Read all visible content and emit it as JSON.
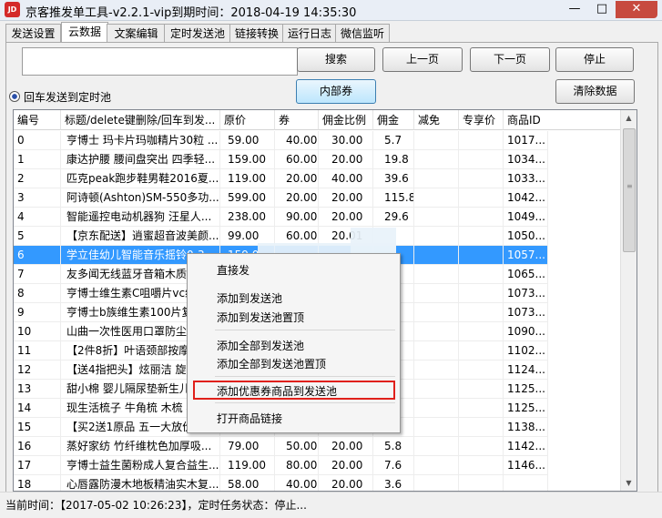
{
  "window": {
    "title": "京客推发单工具-v2.2.1-vip到期时间：2018-04-19 14:35:30",
    "icon_text": "JD"
  },
  "tabs": [
    "发送设置",
    "云数据",
    "文案编辑",
    "定时发送池",
    "链接转换",
    "运行日志",
    "微信监听"
  ],
  "active_tab": 1,
  "toolbar": {
    "search_value": "",
    "search_label": "搜索",
    "prev_label": "上一页",
    "next_label": "下一页",
    "stop_label": "停止",
    "internal_coupon_label": "内部券",
    "clear_label": "清除数据",
    "radio_label": "回车发送到定时池"
  },
  "table": {
    "columns": [
      "编号",
      "标题/delete键删除/回车到发...",
      "原价",
      "券",
      "佣金比例",
      "佣金",
      "减免",
      "专享价",
      "商品ID"
    ],
    "rows": [
      [
        "0",
        "亨博士 玛卡片玛咖精片30粒 ...",
        "59.00",
        "40.00",
        "30.00",
        "5.7",
        "",
        "",
        "1017..."
      ],
      [
        "1",
        "康达护腰 腰间盘突出 四季轻...",
        "159.00",
        "60.00",
        "20.00",
        "19.8",
        "",
        "",
        "1034..."
      ],
      [
        "2",
        "匹克peak跑步鞋男鞋2016夏...",
        "119.00",
        "20.00",
        "40.00",
        "39.6",
        "",
        "",
        "1033..."
      ],
      [
        "3",
        "阿诗顿(Ashton)SM-550多功...",
        "599.00",
        "20.00",
        "20.00",
        "115.8",
        "",
        "",
        "1042..."
      ],
      [
        "4",
        "智能遥控电动机器狗 汪星人...",
        "238.00",
        "90.00",
        "20.00",
        "29.6",
        "",
        "",
        "1049..."
      ],
      [
        "5",
        "【京东配送】逍蜜超音波美颜...",
        "99.00",
        "60.00",
        "20.01",
        "",
        "",
        "",
        "1050..."
      ],
      [
        "6",
        "学立佳幼儿智能音乐摇铃0-3...",
        "159.0",
        "",
        "",
        "",
        "",
        "",
        "1057..."
      ],
      [
        "7",
        "友多闻无线蓝牙音箱木质低音",
        "",
        "",
        "",
        "",
        "",
        "",
        "1065..."
      ],
      [
        "8",
        "亨博士维生素C咀嚼片vc维C",
        "",
        "",
        "",
        "",
        "",
        "",
        "1073..."
      ],
      [
        "9",
        "亨博士b族维生素100片复合",
        "",
        "",
        "",
        "",
        "",
        "",
        "1073..."
      ],
      [
        "10",
        "山曲一次性医用口罩防尘防",
        "",
        "",
        "",
        "",
        "",
        "",
        "1090..."
      ],
      [
        "11",
        "【2件8折】叶语颈部按摩器",
        "",
        "",
        "",
        "",
        "",
        "",
        "1102..."
      ],
      [
        "12",
        "【送4指把头】炫丽洁 旋转",
        "",
        "",
        "",
        "",
        "",
        "",
        "1124..."
      ],
      [
        "13",
        "甜小棉 婴儿隔尿垫新生儿",
        "",
        "",
        "",
        "",
        "",
        "",
        "1125..."
      ],
      [
        "14",
        "现生活梳子 牛角梳 木梳 梳",
        "",
        "",
        "",
        "",
        "",
        "",
        "1125..."
      ],
      [
        "15",
        "【买2送1原品 五一大放价】",
        "",
        "",
        "",
        "",
        "",
        "",
        "1138..."
      ],
      [
        "16",
        "蒸好家纺 竹纤维枕色加厚吸...",
        "79.00",
        "50.00",
        "20.00",
        "5.8",
        "",
        "",
        "1142..."
      ],
      [
        "17",
        "亨博士益生菌粉成人复合益生...",
        "119.00",
        "80.00",
        "20.00",
        "7.6",
        "",
        "",
        "1146..."
      ],
      [
        "18",
        "心唇露防漫木地板精油实木复...",
        "58.00",
        "40.00",
        "20.00",
        "3.6",
        "",
        "",
        ""
      ]
    ],
    "selected_row": 6
  },
  "context_menu": {
    "items": [
      "直接发",
      "添加到发送池",
      "添加到发送池置顶",
      "添加全部到发送池",
      "添加全部到发送池置顶",
      "添加优惠券商品到发送池",
      "打开商品链接"
    ],
    "highlight_color": "#e0201b"
  },
  "status": {
    "text": "当前时间：【2017-05-02 10:26:23】，定时任务状态：停止..."
  },
  "colors": {
    "selection": "#3399ff",
    "close_button": "#c74a3f"
  }
}
